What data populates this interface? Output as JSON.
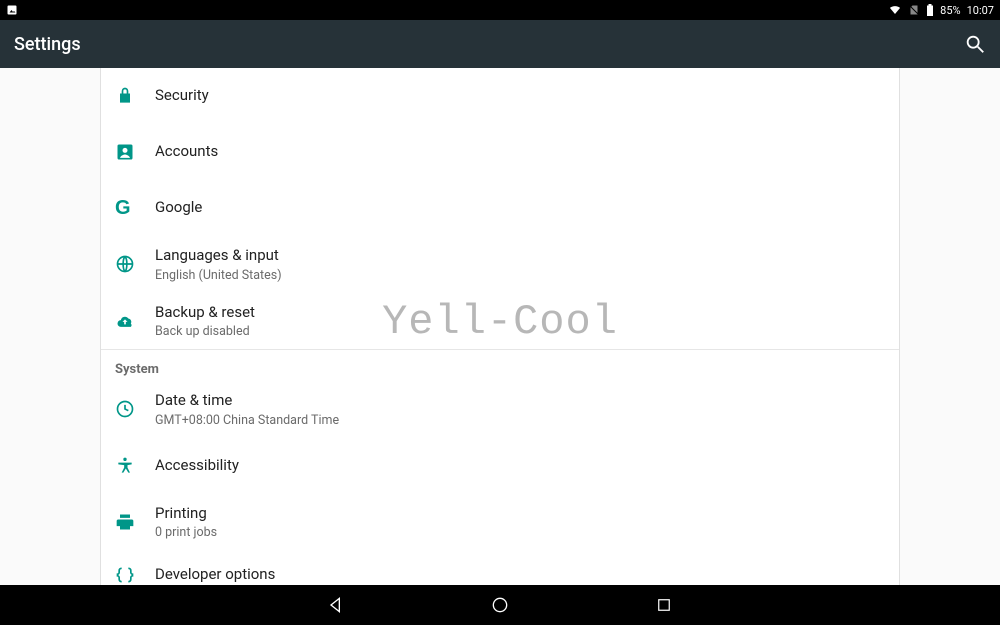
{
  "status": {
    "battery_pct": "85%",
    "time": "10:07"
  },
  "appbar": {
    "title": "Settings"
  },
  "watermark": "Yell-Cool",
  "items": [
    {
      "label": "Security",
      "sub": ""
    },
    {
      "label": "Accounts",
      "sub": ""
    },
    {
      "label": "Google",
      "sub": ""
    },
    {
      "label": "Languages & input",
      "sub": "English (United States)"
    },
    {
      "label": "Backup & reset",
      "sub": "Back up disabled"
    }
  ],
  "system_header": "System",
  "system_items": [
    {
      "label": "Date & time",
      "sub": "GMT+08:00 China Standard Time"
    },
    {
      "label": "Accessibility",
      "sub": ""
    },
    {
      "label": "Printing",
      "sub": "0 print jobs"
    },
    {
      "label": "Developer options",
      "sub": ""
    }
  ]
}
